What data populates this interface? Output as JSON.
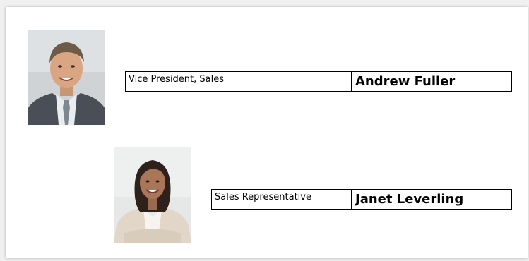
{
  "employees": [
    {
      "title": "Vice President, Sales",
      "name": "Andrew Fuller"
    },
    {
      "title": "Sales Representative",
      "name": "Janet Leverling"
    }
  ],
  "colors": {
    "page_background": "#ffffff",
    "outer_background": "#f0f0f0",
    "border": "#000000"
  }
}
